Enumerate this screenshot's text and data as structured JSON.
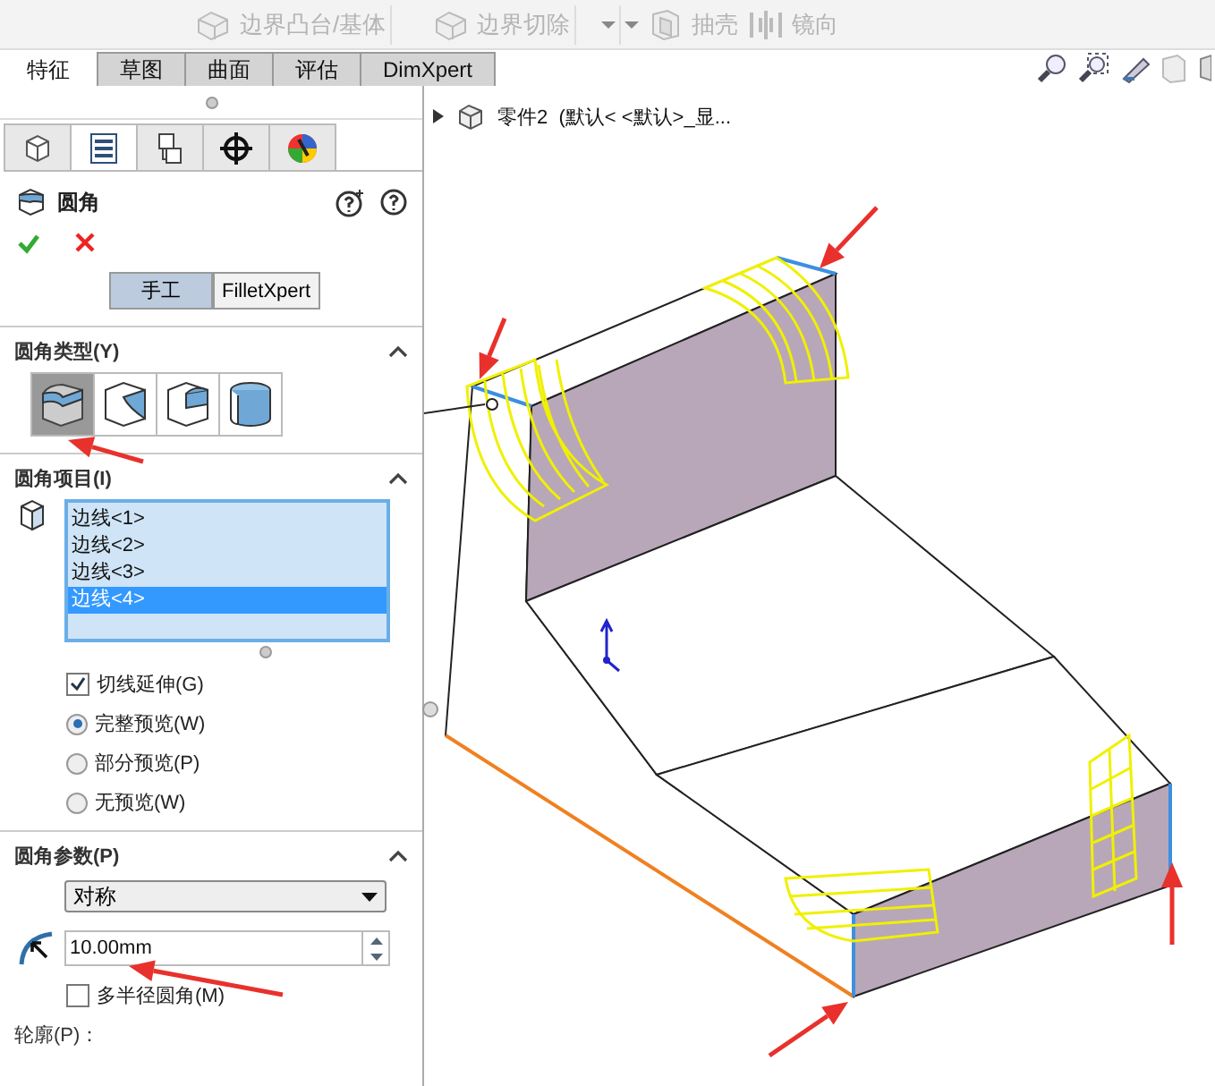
{
  "ribbon": [
    {
      "kind": "button",
      "label": "边界凸台/基体",
      "disabled": true
    },
    {
      "kind": "button",
      "label": "边界切除",
      "disabled": true
    },
    {
      "kind": "dropdown",
      "disabled": true
    },
    {
      "kind": "dropdown",
      "disabled": true
    },
    {
      "kind": "button",
      "label": "抽壳",
      "disabled": true
    },
    {
      "kind": "button",
      "label": "镜向",
      "disabled": true
    }
  ],
  "command_tabs": [
    {
      "label": "特征",
      "selected": true
    },
    {
      "label": "草图",
      "selected": false
    },
    {
      "label": "曲面",
      "selected": false
    },
    {
      "label": "评估",
      "selected": false
    },
    {
      "label": "DimXpert",
      "selected": false
    }
  ],
  "panel_tabs": [
    {
      "selected": false
    },
    {
      "selected": true
    },
    {
      "selected": false
    },
    {
      "selected": false
    },
    {
      "selected": false
    }
  ],
  "feature": {
    "title": "圆角"
  },
  "mode_buttons": [
    {
      "label": "手工",
      "selected": true
    },
    {
      "label": "FilletXpert",
      "selected": false
    }
  ],
  "fillet_type": {
    "title": "圆角类型(Y)",
    "expanded": true,
    "options": [
      {
        "selected": true
      },
      {
        "selected": false
      },
      {
        "selected": false
      },
      {
        "selected": false
      }
    ]
  },
  "fillet_items": {
    "title": "圆角项目(I)",
    "expanded": true,
    "edges": [
      {
        "label": "边线<1>",
        "selected": false
      },
      {
        "label": "边线<2>",
        "selected": false
      },
      {
        "label": "边线<3>",
        "selected": false
      },
      {
        "label": "边线<4>",
        "selected": true
      }
    ],
    "options": [
      {
        "kind": "checkbox",
        "label": "切线延伸(G)",
        "checked": true
      },
      {
        "kind": "radio",
        "label": "完整预览(W)",
        "selected": true
      },
      {
        "kind": "radio",
        "label": "部分预览(P)",
        "selected": false
      },
      {
        "kind": "radio",
        "label": "无预览(W)",
        "selected": false
      }
    ]
  },
  "fillet_params": {
    "title": "圆角参数(P)",
    "expanded": true,
    "method": {
      "value": "对称"
    },
    "radius": {
      "value": "10.00mm"
    },
    "multi_radius": {
      "label": "多半径圆角(M)",
      "checked": false
    },
    "profile": {
      "label": "轮廓(P)："
    }
  },
  "viewport": {
    "tree_label": "零件2  (默认< <默认>_显...",
    "expanded": false
  }
}
